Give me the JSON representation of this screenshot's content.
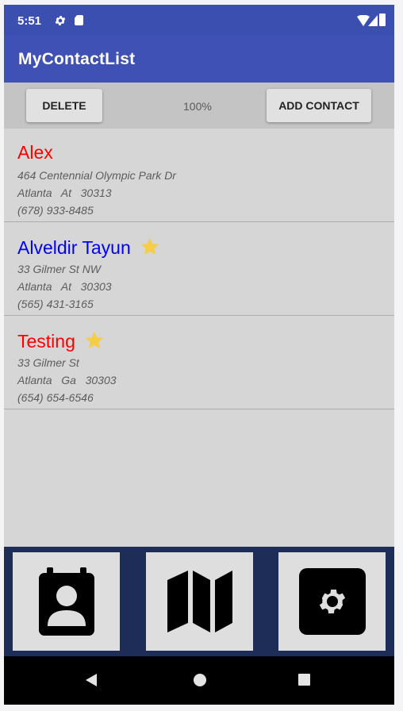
{
  "status_bar": {
    "time": "5:51"
  },
  "app_bar": {
    "title": "MyContactList"
  },
  "toolbar": {
    "delete_label": "DELETE",
    "zoom": "100%",
    "add_label": "ADD CONTACT"
  },
  "colors": {
    "primary": "#3f51b5",
    "status_bar": "#3b4fb0",
    "list_bg": "#d6d6d6",
    "nav_bg": "#1e2d58",
    "red_name": "#ff0000",
    "blue_name": "#0000ff",
    "star": "#f5cd47"
  },
  "contacts": [
    {
      "name": "Alex",
      "name_color": "#ff0000",
      "starred": false,
      "street": "464 Centennial Olympic Park Dr",
      "city_line": "Atlanta   At   30313",
      "phone": "(678) 933-8485"
    },
    {
      "name": "Alveldir Tayun",
      "name_color": "#0000ff",
      "starred": true,
      "street": "33 Gilmer St NW",
      "city_line": "Atlanta   At   30303",
      "phone": "(565) 431-3165"
    },
    {
      "name": "Testing",
      "name_color": "#ff0000",
      "starred": true,
      "street": "33 Gilmer St",
      "city_line": "Atlanta   Ga   30303",
      "phone": "(654) 654-6546"
    }
  ],
  "bottom_nav": {
    "icons": [
      "contacts-icon",
      "map-icon",
      "settings-icon"
    ]
  },
  "system_nav": {
    "icons": [
      "back-icon",
      "home-icon",
      "recents-icon"
    ]
  }
}
